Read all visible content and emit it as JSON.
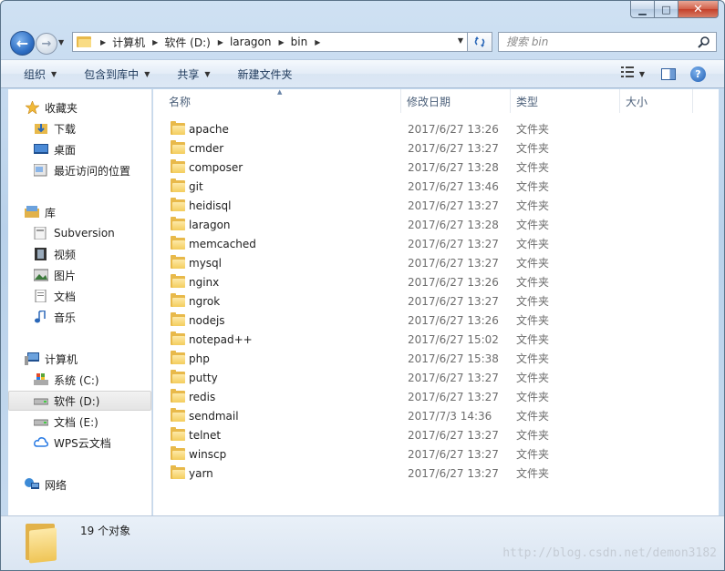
{
  "window": {
    "caption_buttons": {
      "minimize": "▁",
      "maximize": "□",
      "close": "✕"
    }
  },
  "address": {
    "back_glyph": "←",
    "forward_glyph": "→",
    "breadcrumbs": [
      "计算机",
      "软件 (D:)",
      "laragon",
      "bin"
    ],
    "search_placeholder": "搜索 bin"
  },
  "toolbar": {
    "organize": "组织",
    "include_in_library": "包含到库中",
    "share": "共享",
    "new_folder": "新建文件夹",
    "help_glyph": "?"
  },
  "nav": {
    "favorites": "收藏夹",
    "downloads": "下载",
    "desktop": "桌面",
    "recent": "最近访问的位置",
    "libraries": "库",
    "subversion": "Subversion",
    "videos": "视频",
    "pictures": "图片",
    "documents": "文档",
    "music": "音乐",
    "computer": "计算机",
    "drive_c": "系统 (C:)",
    "drive_d": "软件 (D:)",
    "drive_e": "文档 (E:)",
    "wps": "WPS云文档",
    "network": "网络"
  },
  "columns": {
    "name": "名称",
    "date": "修改日期",
    "type": "类型",
    "size": "大小"
  },
  "files": [
    {
      "name": "apache",
      "date": "2017/6/27 13:26",
      "type": "文件夹"
    },
    {
      "name": "cmder",
      "date": "2017/6/27 13:27",
      "type": "文件夹"
    },
    {
      "name": "composer",
      "date": "2017/6/27 13:28",
      "type": "文件夹"
    },
    {
      "name": "git",
      "date": "2017/6/27 13:46",
      "type": "文件夹"
    },
    {
      "name": "heidisql",
      "date": "2017/6/27 13:27",
      "type": "文件夹"
    },
    {
      "name": "laragon",
      "date": "2017/6/27 13:28",
      "type": "文件夹"
    },
    {
      "name": "memcached",
      "date": "2017/6/27 13:27",
      "type": "文件夹"
    },
    {
      "name": "mysql",
      "date": "2017/6/27 13:27",
      "type": "文件夹"
    },
    {
      "name": "nginx",
      "date": "2017/6/27 13:26",
      "type": "文件夹"
    },
    {
      "name": "ngrok",
      "date": "2017/6/27 13:27",
      "type": "文件夹"
    },
    {
      "name": "nodejs",
      "date": "2017/6/27 13:26",
      "type": "文件夹"
    },
    {
      "name": "notepad++",
      "date": "2017/6/27 15:02",
      "type": "文件夹"
    },
    {
      "name": "php",
      "date": "2017/6/27 15:38",
      "type": "文件夹"
    },
    {
      "name": "putty",
      "date": "2017/6/27 13:27",
      "type": "文件夹"
    },
    {
      "name": "redis",
      "date": "2017/6/27 13:27",
      "type": "文件夹"
    },
    {
      "name": "sendmail",
      "date": "2017/7/3 14:36",
      "type": "文件夹"
    },
    {
      "name": "telnet",
      "date": "2017/6/27 13:27",
      "type": "文件夹"
    },
    {
      "name": "winscp",
      "date": "2017/6/27 13:27",
      "type": "文件夹"
    },
    {
      "name": "yarn",
      "date": "2017/6/27 13:27",
      "type": "文件夹"
    }
  ],
  "status": {
    "item_count": "19 个对象"
  },
  "watermark": "http://blog.csdn.net/demon3182"
}
